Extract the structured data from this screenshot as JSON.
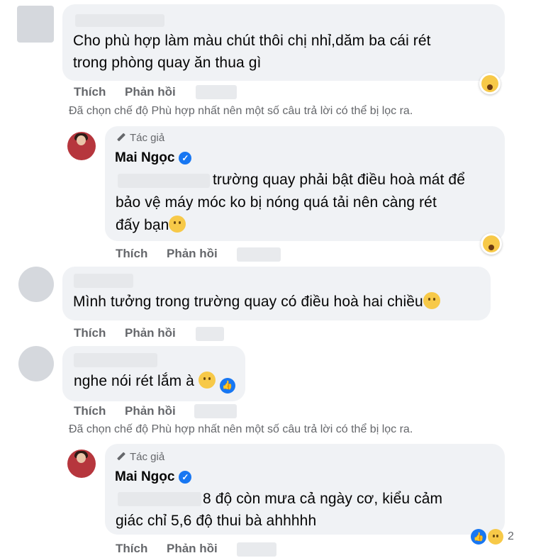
{
  "filter_note": "Đã chọn chế độ Phù hợp nhất nên một số câu trả lời có thể bị lọc ra.",
  "actions": {
    "like": "Thích",
    "reply": "Phản hồi"
  },
  "author_tag": "Tác giả",
  "comments": [
    {
      "lines": [
        "Cho phù hợp làm màu chút thôi chị nhỉ,dăm ba cái rét",
        "trong phòng quay ăn thua gì"
      ],
      "reaction": "wow-icon"
    },
    {
      "author": "Mai Ngọc",
      "lines": [
        "trường quay phải bật điều hoà mát để",
        "bảo vệ máy móc ko bị nóng quá tải nên càng rét",
        "đấy bạn"
      ],
      "reaction": "care-icon"
    },
    {
      "lines": [
        "Mình tưởng trong trường quay có điều hoà hai chiều"
      ]
    },
    {
      "lines": [
        "nghe nói rét lắm à"
      ]
    },
    {
      "author": "Mai Ngọc",
      "lines": [
        "8 độ còn mưa cả ngày cơ, kiểu cảm",
        "giác chỉ 5,6 độ thui bà ahhhhh"
      ],
      "reaction_count": "2"
    }
  ],
  "colors": {
    "bubble": "#f0f2f5",
    "meta": "#65676b",
    "verified": "#1877f2"
  }
}
